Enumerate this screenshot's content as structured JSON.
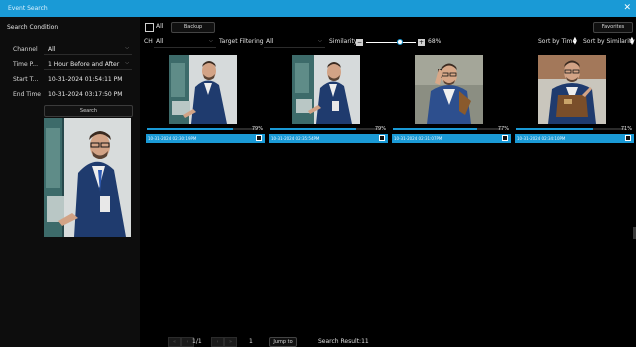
{
  "window": {
    "title": "Event Search",
    "close_icon": "close-icon"
  },
  "left_panel": {
    "title": "Search Condition",
    "fields": [
      {
        "label": "Channel",
        "value": "All"
      },
      {
        "label": "Time P...",
        "value": "1 Hour Before and After"
      },
      {
        "label": "Start T...",
        "value": "10-31-2024   01:54:11 PM"
      },
      {
        "label": "End Time",
        "value": "10-31-2024   03:17:50 PM"
      }
    ],
    "search_button": "Search"
  },
  "toolbar": {
    "all_label": "All",
    "backup_label": "Backup",
    "favorites_label": "Favorites",
    "ch_label": "CH",
    "ch_value": "All",
    "target_filter_label": "Target Filtering",
    "target_filter_value": "All",
    "similarity_label": "Similarity",
    "similarity_value": "68%",
    "similarity_fraction": 0.68,
    "minus_label": "−",
    "plus_label": "+",
    "sort_time_label": "Sort by Time",
    "sort_similarity_label": "Sort by Similarity"
  },
  "results": [
    {
      "percent": "79%",
      "fraction": 0.79,
      "timestamp": "10-31-2024 02:30:19PM"
    },
    {
      "percent": "79%",
      "fraction": 0.79,
      "timestamp": "10-31-2024 02:35:54PM"
    },
    {
      "percent": "77%",
      "fraction": 0.77,
      "timestamp": "10-31-2024 02:31:07PM"
    },
    {
      "percent": "71%",
      "fraction": 0.71,
      "timestamp": "10-31-2024 02:34:10PM"
    }
  ],
  "footer": {
    "page_indicator": "1/1",
    "page_input": "1",
    "jump_label": "Jump to",
    "result_label": "Search Result:11"
  },
  "colors": {
    "accent": "#1a9ad6",
    "background": "#000000",
    "panel": "#0d0d0d"
  }
}
